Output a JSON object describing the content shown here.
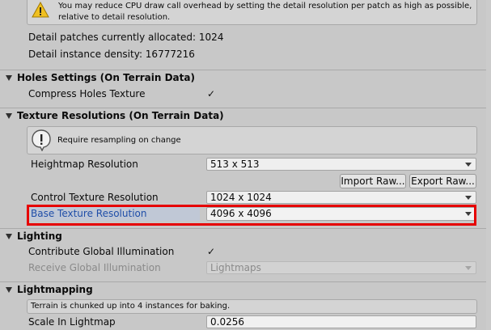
{
  "top_warning": {
    "icon": "warning-icon",
    "text_line1": "You may reduce CPU draw call overhead by setting the detail resolution per patch as high as possible,",
    "text_line2": "relative to detail resolution."
  },
  "detail_info": {
    "patches_allocated": "Detail patches currently allocated: 1024",
    "instance_density": "Detail instance density: 16777216"
  },
  "holes_section": {
    "title": "Holes Settings (On Terrain Data)",
    "compress_label": "Compress Holes Texture",
    "compress_checked": "✓"
  },
  "texture_section": {
    "title": "Texture Resolutions (On Terrain Data)",
    "info_icon": "info-icon",
    "info_text": "Require resampling on change",
    "heightmap_label": "Heightmap Resolution",
    "heightmap_value": "513 x 513",
    "import_raw": "Import Raw...",
    "export_raw": "Export Raw...",
    "control_label": "Control Texture Resolution",
    "control_value": "1024 x 1024",
    "base_label": "Base Texture Resolution",
    "base_value": "4096 x 4096",
    "highlight_color": "#e60000"
  },
  "lighting_section": {
    "title": "Lighting",
    "contribute_label": "Contribute Global Illumination",
    "contribute_checked": "✓",
    "receive_label": "Receive Global Illumination",
    "receive_value": "Lightmaps"
  },
  "lightmapping_section": {
    "title": "Lightmapping",
    "info_text": "Terrain is chunked up into 4 instances for baking.",
    "scale_label": "Scale In Lightmap",
    "scale_value": "0.0256"
  }
}
